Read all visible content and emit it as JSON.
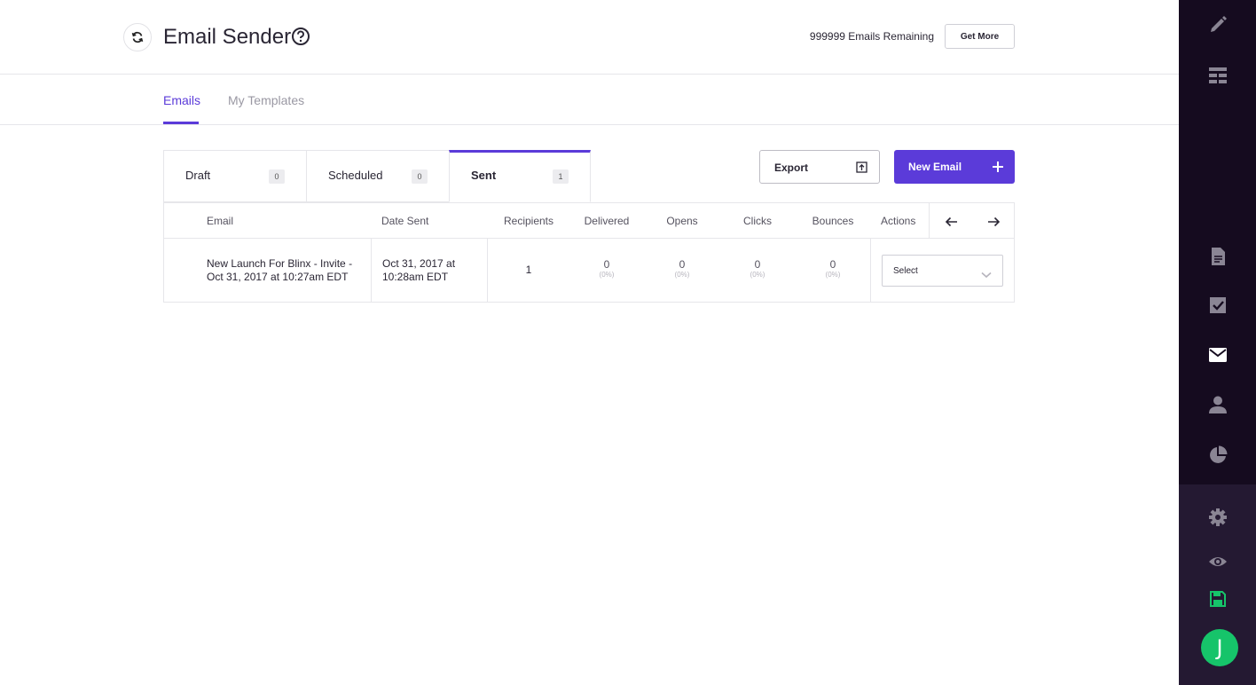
{
  "header": {
    "title": "Email Sender",
    "remaining": "999999 Emails Remaining",
    "get_more_label": "Get More"
  },
  "subnav": {
    "tabs": [
      {
        "label": "Emails",
        "active": true
      },
      {
        "label": "My Templates",
        "active": false
      }
    ]
  },
  "status_tabs": [
    {
      "label": "Draft",
      "count": "0"
    },
    {
      "label": "Scheduled",
      "count": "0"
    },
    {
      "label": "Sent",
      "count": "1",
      "active": true
    }
  ],
  "toolbar": {
    "export_label": "Export",
    "new_email_label": "New Email"
  },
  "table": {
    "columns": [
      "Email",
      "Date Sent",
      "Recipients",
      "Delivered",
      "Opens",
      "Clicks",
      "Bounces",
      "Actions"
    ],
    "rows": [
      {
        "email_line1": "New Launch For Blinx - Invite -",
        "email_line2": "Oct 31, 2017 at 10:27am EDT",
        "date_line1": "Oct 31, 2017 at",
        "date_line2": "10:28am EDT",
        "recipients": "1",
        "delivered": "0",
        "delivered_pct": "(0%)",
        "opens": "0",
        "opens_pct": "(0%)",
        "clicks": "0",
        "clicks_pct": "(0%)",
        "bounces": "0",
        "bounces_pct": "(0%)",
        "action_select": "Select"
      }
    ]
  },
  "sidebar": {
    "icons": [
      "pencil-icon",
      "layout-icon",
      "document-icon",
      "checkbox-icon",
      "mail-icon",
      "user-icon",
      "pie-chart-icon",
      "gear-icon",
      "eye-icon",
      "save-icon"
    ],
    "avatar_initial": "J",
    "accent": "#16c46a"
  },
  "colors": {
    "brand": "#5b3bd9",
    "sidebar_bg": "#150b1f"
  }
}
